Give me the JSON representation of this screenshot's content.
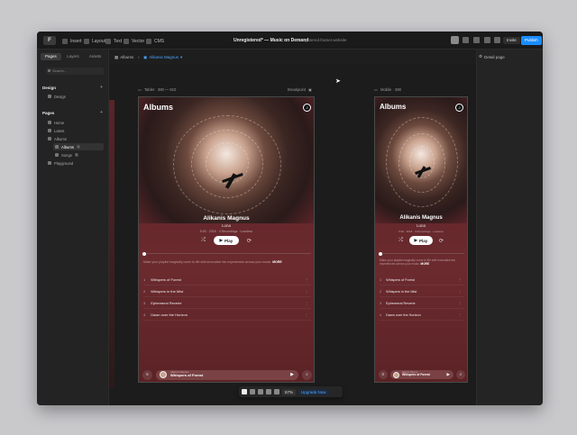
{
  "window": {
    "title": "Unregistered* — Music on Demand",
    "subtitle": "unregistered.framer.website"
  },
  "topbar": {
    "logo": "F",
    "tools": [
      {
        "label": "Insert",
        "icon": "plus-icon"
      },
      {
        "label": "Layout",
        "icon": "layout-icon"
      },
      {
        "label": "Text",
        "icon": "text-icon"
      },
      {
        "label": "Vector",
        "icon": "vector-icon"
      },
      {
        "label": "CMS",
        "icon": "database-icon"
      }
    ],
    "invite_label": "Invite",
    "publish_label": "Publish"
  },
  "breadcrumbs": {
    "items": [
      "Albums",
      "Alikanis Magnus"
    ],
    "detail_label": "Detail page"
  },
  "sidebar": {
    "tabs": [
      "Pages",
      "Layers",
      "Assets"
    ],
    "search_placeholder": "Search...",
    "design_heading": "Design",
    "design_items": [
      "Design"
    ],
    "pages_heading": "Pages",
    "pages": [
      {
        "label": "Home",
        "indent": 0
      },
      {
        "label": "Latest",
        "indent": 0
      },
      {
        "label": "Albums",
        "indent": 0
      },
      {
        "label": "Albums",
        "indent": 1,
        "selected": true,
        "badge": "1"
      },
      {
        "label": "Songs",
        "indent": 1,
        "badge": "1"
      },
      {
        "label": "Playground",
        "indent": 0
      }
    ]
  },
  "frames": {
    "desktop": {
      "label": "Tablet · 390 — 810",
      "breakpoint_label": "Breakpoint"
    },
    "mobile": {
      "label": "Mobile · 390"
    }
  },
  "album": {
    "heading": "Albums",
    "artist": "Alikanis Magnus",
    "album_title": "Luna",
    "meta": "5:00 · 2018 · 4 Recordings · Lossless",
    "play_label": "Play",
    "description_desktop": "Make your playlist magically come to life with innovative fan experiences across your music.",
    "description_mobile": "Make your playlist magically come to life with innovative fan experiences across your music.",
    "description_link": "MORE",
    "tracks": [
      {
        "n": "1",
        "title": "Whispers of Forest"
      },
      {
        "n": "2",
        "title": "Whispers in the Mist"
      },
      {
        "n": "3",
        "title": "Ephemeral Reverie"
      },
      {
        "n": "4",
        "title": "Dawn over the Horizon"
      }
    ],
    "now_playing": {
      "caption": "Alikanis Magnus",
      "title": "Whispers of Forest"
    }
  },
  "bottombar": {
    "zoom": "67%",
    "upgrade_label": "Upgrade Now"
  }
}
